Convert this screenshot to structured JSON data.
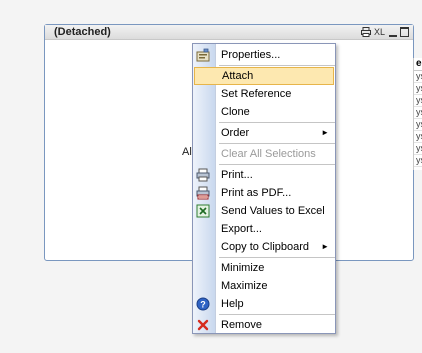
{
  "sheet_object": {
    "title": "(Detached)",
    "xl_label": "XL",
    "body_text": "All"
  },
  "listbox": {
    "header": "er",
    "rows": [
      "ys",
      "ys",
      "ys",
      "ys",
      "ys",
      "ys",
      "ys",
      "ys",
      "ys"
    ]
  },
  "context_menu": {
    "items": {
      "properties": "Properties...",
      "attach": "Attach",
      "set_reference": "Set Reference",
      "clone": "Clone",
      "order": "Order",
      "clear_all_selections": "Clear All Selections",
      "print": "Print...",
      "print_pdf": "Print as PDF...",
      "send_excel": "Send Values to Excel",
      "export": "Export...",
      "copy_clipboard": "Copy to Clipboard",
      "minimize": "Minimize",
      "maximize": "Maximize",
      "help": "Help",
      "remove": "Remove"
    },
    "submenu_arrow": "►"
  },
  "colors": {
    "highlight_bg": "#fde8b0",
    "highlight_border": "#e7b54a",
    "menu_border": "#8a96b8",
    "window_border": "#7a97bf"
  },
  "icons": {
    "properties": "properties-icon",
    "print": "printer-icon",
    "print_pdf": "pdf-printer-icon",
    "send_excel": "excel-icon",
    "help": "help-icon",
    "remove": "remove-x-icon"
  }
}
